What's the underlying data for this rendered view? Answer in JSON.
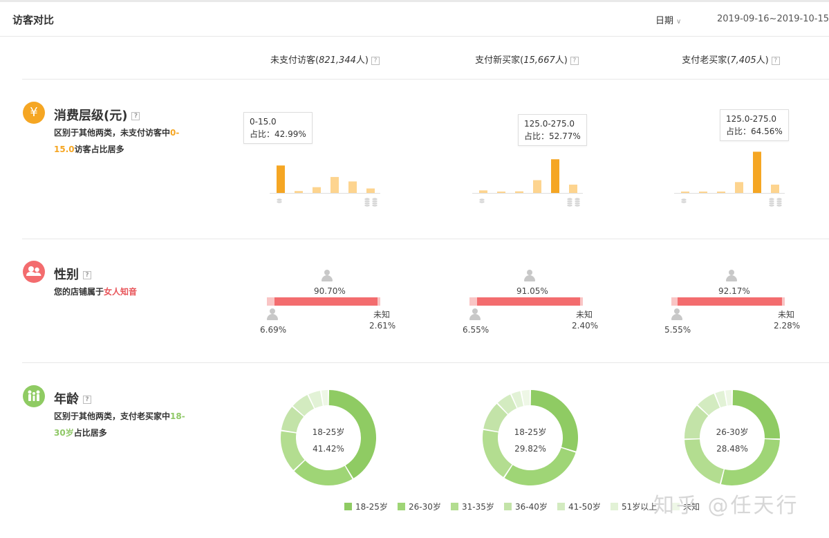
{
  "header": {
    "title": "访客对比",
    "date_label": "日期",
    "date_range": "2019-09-16~2019-10-15"
  },
  "columns": [
    {
      "label": "未支付访客",
      "count": "821,344",
      "unit": "人"
    },
    {
      "label": "支付新买家",
      "count": "15,667",
      "unit": "人"
    },
    {
      "label": "支付老买家",
      "count": "7,405",
      "unit": "人"
    }
  ],
  "help_mark": "?",
  "sections": {
    "spending": {
      "title": "消费层级(元)",
      "desc_pre": "区别于其他两类，未支付访客中",
      "desc_hl": "0-15.0",
      "desc_post": "访客占比居多",
      "icon": "yen-icon"
    },
    "gender": {
      "title": "性别",
      "desc_pre": "您的店铺属于",
      "desc_hl": "女人知音",
      "icon": "users-icon"
    },
    "age": {
      "title": "年龄",
      "desc_pre": "区别于其他两类，支付老买家中",
      "desc_hl": "18-30岁",
      "desc_post": "占比居多",
      "icon": "family-icon"
    }
  },
  "spending_charts": [
    {
      "tip_range": "0-15.0",
      "tip_ratio": "占比：42.99%",
      "highlight": 0
    },
    {
      "tip_range": "125.0-275.0",
      "tip_ratio": "占比：52.77%",
      "highlight": 4
    },
    {
      "tip_range": "125.0-275.0",
      "tip_ratio": "占比：64.56%",
      "highlight": 4
    }
  ],
  "gender_data": [
    {
      "female": "90.70%",
      "male": "6.69%",
      "unknown_label": "未知",
      "unknown": "2.61%"
    },
    {
      "female": "91.05%",
      "male": "6.55%",
      "unknown_label": "未知",
      "unknown": "2.40%"
    },
    {
      "female": "92.17%",
      "male": "5.55%",
      "unknown_label": "未知",
      "unknown": "2.28%"
    }
  ],
  "age_donuts": [
    {
      "center_label": "18-25岁",
      "center_value": "41.42%"
    },
    {
      "center_label": "18-25岁",
      "center_value": "29.82%"
    },
    {
      "center_label": "26-30岁",
      "center_value": "28.48%"
    }
  ],
  "age_legend": [
    "18-25岁",
    "26-30岁",
    "31-35岁",
    "36-40岁",
    "41-50岁",
    "51岁以上",
    "未知"
  ],
  "watermark": "知乎 @任天行",
  "colors": {
    "orange": "#f5a623",
    "orange_light": "#fdd48f",
    "red": "#f36c6e",
    "red_light": "#f9c5c5",
    "green_scale": [
      "#8fcb63",
      "#9fd576",
      "#b3dd90",
      "#c3e3a8",
      "#d3ebc0",
      "#e2f2d6",
      "#eef7e6"
    ]
  },
  "chart_data": [
    {
      "type": "bar",
      "title": "消费层级(元)",
      "series": [
        {
          "name": "未支付访客",
          "values": [
            42.99,
            3,
            9,
            25,
            18,
            7
          ]
        },
        {
          "name": "支付新买家",
          "values": [
            4,
            1.5,
            2.5,
            20,
            52.77,
            13
          ]
        },
        {
          "name": "支付老买家",
          "values": [
            2,
            2,
            1.5,
            17,
            64.56,
            13
          ]
        }
      ]
    },
    {
      "type": "pie",
      "title": "年龄",
      "categories": [
        "18-25岁",
        "26-30岁",
        "31-35岁",
        "36-40岁",
        "41-50岁",
        "51岁以上",
        "未知"
      ],
      "series": [
        {
          "name": "未支付访客",
          "values": [
            41.42,
            21.5,
            14.5,
            9,
            6.5,
            4.5,
            2.58
          ]
        },
        {
          "name": "支付新买家",
          "values": [
            29.82,
            29.5,
            18.5,
            10,
            5.5,
            3.5,
            3.18
          ]
        },
        {
          "name": "支付老买家",
          "values": [
            25.5,
            28.48,
            20.5,
            12.5,
            7,
            3.5,
            2.52
          ]
        }
      ]
    }
  ]
}
